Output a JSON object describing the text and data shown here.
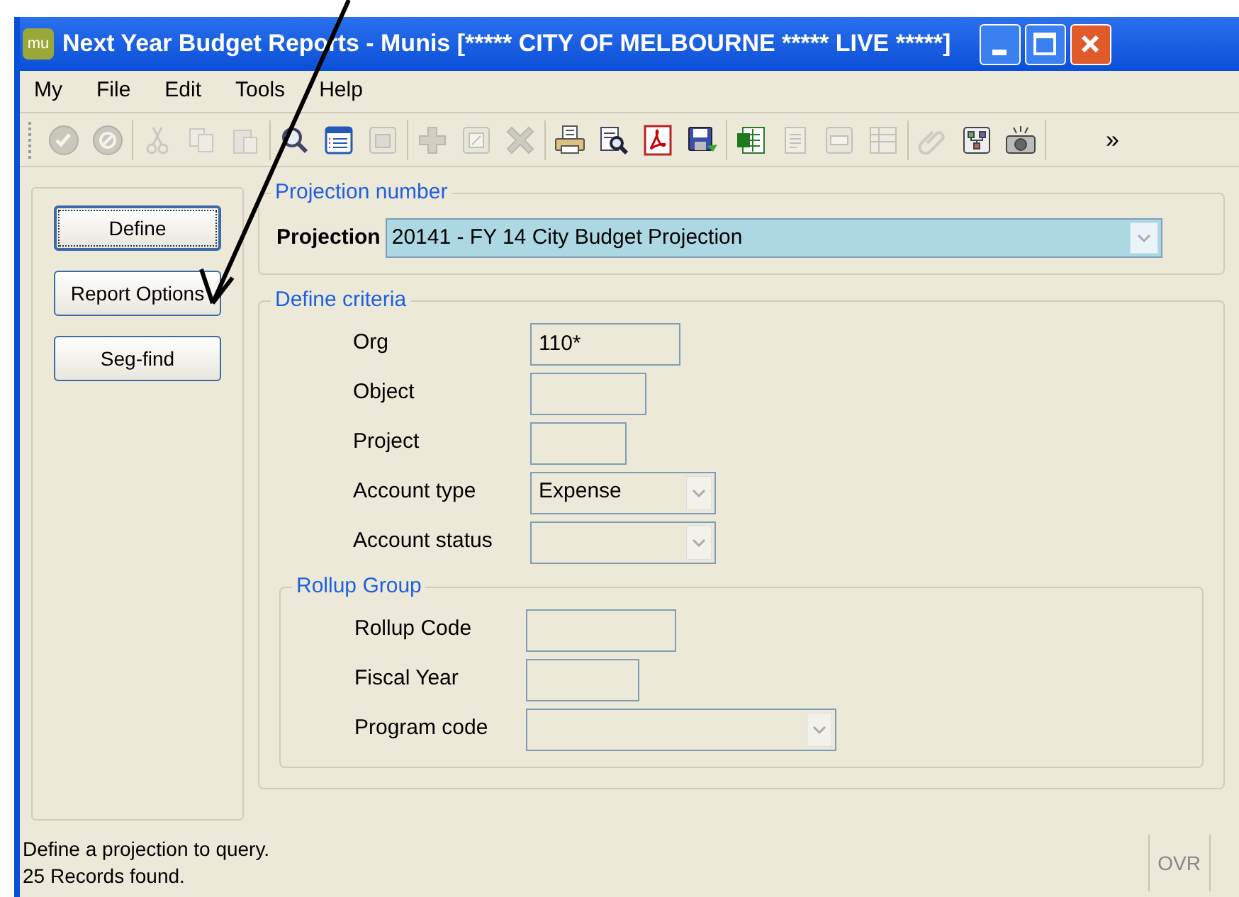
{
  "window": {
    "app_badge": "mu",
    "title": "Next Year Budget Reports - Munis [***** CITY OF MELBOURNE ***** LIVE *****]"
  },
  "menu": [
    "My",
    "File",
    "Edit",
    "Tools",
    "Help"
  ],
  "toolbar": [
    [
      {
        "kind": "accept",
        "disabled": true
      },
      {
        "kind": "cancel",
        "disabled": true
      }
    ],
    [
      {
        "kind": "cut",
        "disabled": true
      },
      {
        "kind": "copy",
        "disabled": true
      },
      {
        "kind": "paste",
        "disabled": true
      }
    ],
    [
      {
        "kind": "search",
        "disabled": false
      },
      {
        "kind": "browse",
        "disabled": false
      },
      {
        "kind": "grid",
        "disabled": true
      }
    ],
    [
      {
        "kind": "add",
        "disabled": true
      },
      {
        "kind": "update",
        "disabled": true
      },
      {
        "kind": "delete",
        "disabled": true
      }
    ],
    [
      {
        "kind": "print",
        "disabled": false
      },
      {
        "kind": "preview",
        "disabled": false
      },
      {
        "kind": "pdf",
        "disabled": false
      },
      {
        "kind": "save",
        "disabled": false
      }
    ],
    [
      {
        "kind": "excel",
        "disabled": false
      },
      {
        "kind": "word",
        "disabled": true
      },
      {
        "kind": "form",
        "disabled": true
      },
      {
        "kind": "table",
        "disabled": true
      }
    ],
    [
      {
        "kind": "attach",
        "disabled": true
      },
      {
        "kind": "tree",
        "disabled": false
      },
      {
        "kind": "camera",
        "disabled": false
      }
    ]
  ],
  "toolbar_more": "»",
  "side_buttons": [
    {
      "label": "Define",
      "focused": true
    },
    {
      "label": "Report Options",
      "focused": false
    },
    {
      "label": "Seg-find",
      "focused": false
    }
  ],
  "projection_group": {
    "legend": "Projection number",
    "label": "Projection",
    "value": "20141 - FY 14 City Budget Projection"
  },
  "criteria_group": {
    "legend": "Define criteria",
    "fields": [
      {
        "label": "Org",
        "kind": "text",
        "value": "110*"
      },
      {
        "label": "Object",
        "kind": "text"
      },
      {
        "label": "Project",
        "kind": "text"
      },
      {
        "label": "Account type",
        "kind": "select",
        "value": "Expense"
      },
      {
        "label": "Account status",
        "kind": "select"
      }
    ]
  },
  "rollup_group": {
    "legend": "Rollup Group",
    "fields": [
      {
        "label": "Rollup Code",
        "kind": "text"
      },
      {
        "label": "Fiscal Year",
        "kind": "text"
      },
      {
        "label": "Program code",
        "kind": "select"
      }
    ]
  },
  "status_bar": {
    "lines": [
      "Define a projection to query.",
      "25 Records found."
    ],
    "mode": "OVR"
  }
}
